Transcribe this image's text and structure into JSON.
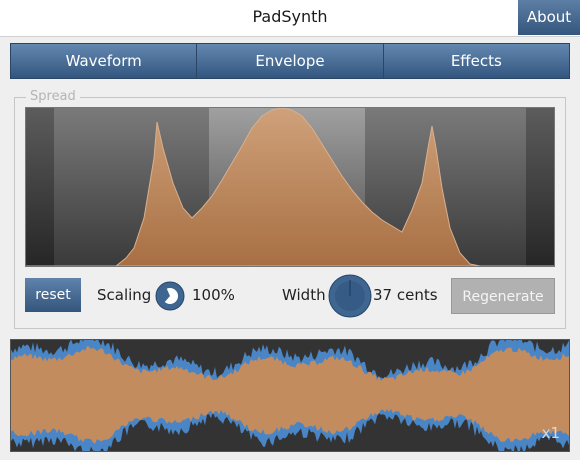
{
  "app": {
    "title": "PadSynth",
    "about_label": "About"
  },
  "tabs": [
    "Waveform",
    "Envelope",
    "Effects"
  ],
  "spread": {
    "group_label": "Spread",
    "reset_label": "reset",
    "scaling_label": "Scaling",
    "scaling_value": "100%",
    "scaling_fraction": 0.75,
    "width_label": "Width",
    "width_value": "37 cents",
    "width_fraction": 0.5,
    "regenerate_label": "Regenerate"
  },
  "waveform": {
    "zoom_label": "x1"
  },
  "colors": {
    "accent_blue": "#3e6691",
    "fill_orange": "#c38c5f",
    "wave_blue": "#4a86c5"
  }
}
